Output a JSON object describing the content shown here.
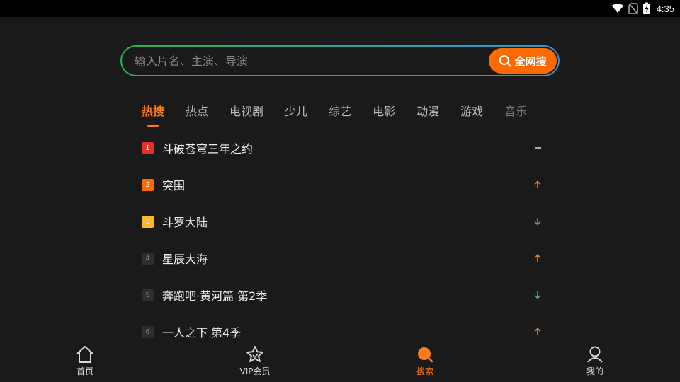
{
  "status_bar": {
    "time": "4:35",
    "icons": [
      "wifi-icon",
      "no-sim-icon",
      "battery-charging-icon"
    ]
  },
  "search": {
    "placeholder": "输入片名、主演、导演",
    "value": "",
    "button_label": "全网搜",
    "button_icon": "search-icon"
  },
  "tabs": [
    {
      "label": "热搜",
      "active": true
    },
    {
      "label": "热点"
    },
    {
      "label": "电视剧"
    },
    {
      "label": "少儿"
    },
    {
      "label": "综艺"
    },
    {
      "label": "电影"
    },
    {
      "label": "动漫"
    },
    {
      "label": "游戏"
    },
    {
      "label": "音乐"
    }
  ],
  "hot_list": [
    {
      "rank": "1",
      "title": "斗破苍穹三年之约",
      "trend": "flat"
    },
    {
      "rank": "2",
      "title": "突围",
      "trend": "up"
    },
    {
      "rank": "3",
      "title": "斗罗大陆",
      "trend": "down"
    },
    {
      "rank": "4",
      "title": "星辰大海",
      "trend": "up"
    },
    {
      "rank": "5",
      "title": "奔跑吧·黄河篇 第2季",
      "trend": "down"
    },
    {
      "rank": "6",
      "title": "一人之下 第4季",
      "trend": "up"
    }
  ],
  "bottom_nav": [
    {
      "label": "首页",
      "icon": "home-icon"
    },
    {
      "label": "VIP会员",
      "icon": "vip-star-icon"
    },
    {
      "label": "搜索",
      "icon": "search-icon",
      "active": true
    },
    {
      "label": "我的",
      "icon": "profile-icon"
    }
  ],
  "colors": {
    "accent": "#ff7a1a",
    "trend_up": "#ff7a1a",
    "trend_down": "#3cb371",
    "rank1": "#e5322d",
    "rank2": "#ff6a00",
    "rank3": "#ffb72b"
  }
}
